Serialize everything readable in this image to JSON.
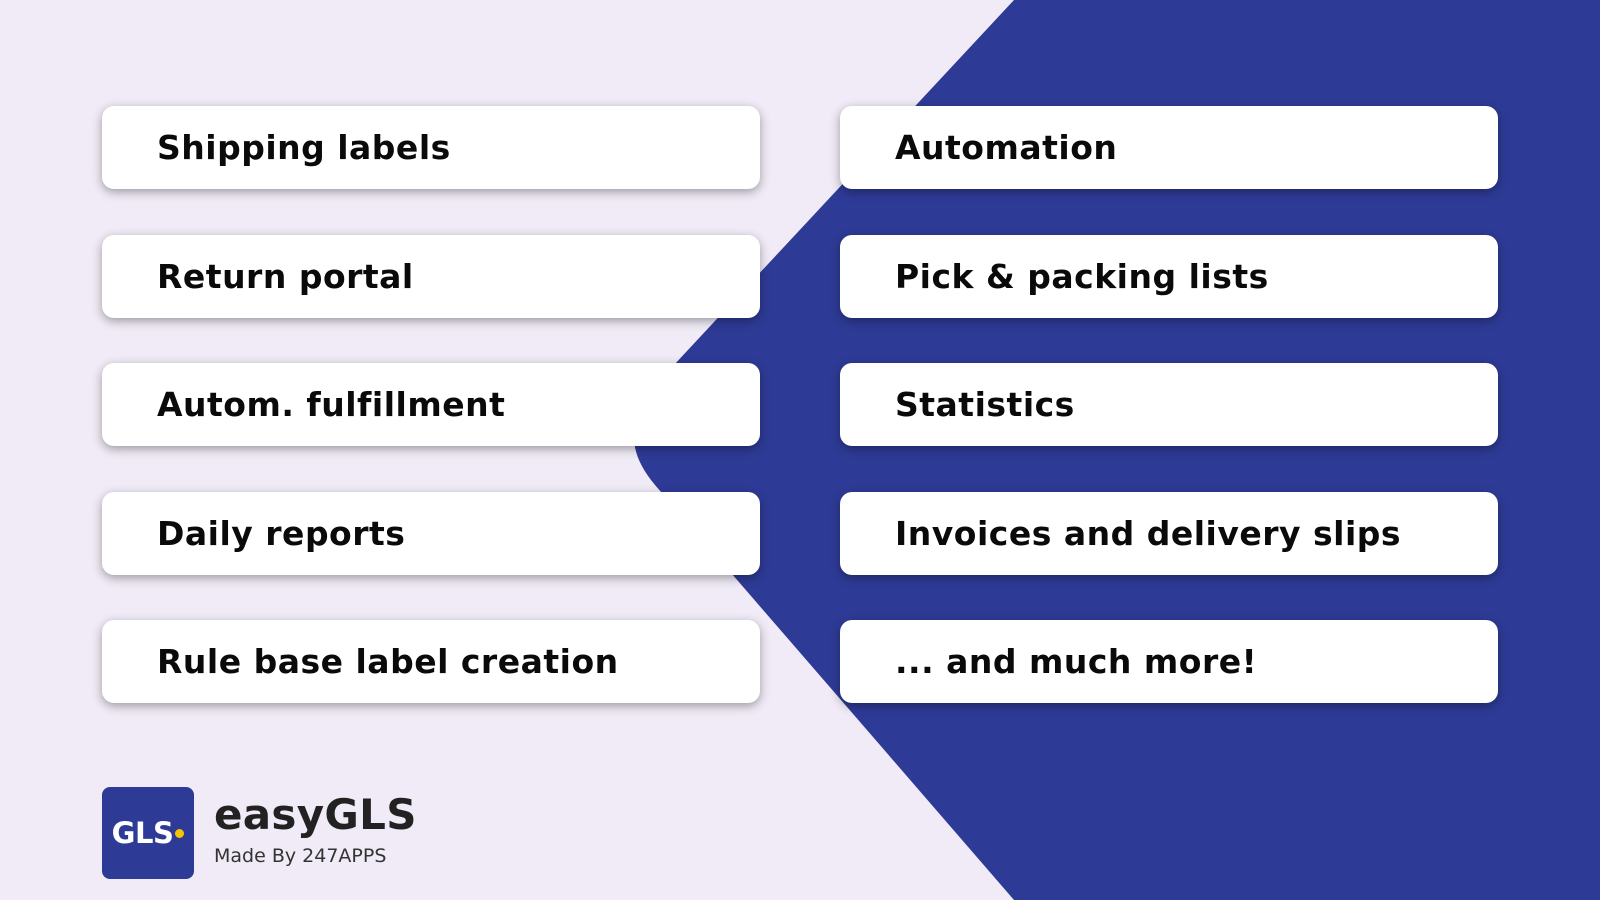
{
  "colors": {
    "background": "#f0ebf6",
    "accent_blue": "#2e3b96",
    "card": "#ffffff",
    "text": "#0a0a0a",
    "logo_dot": "#f5c400"
  },
  "features": {
    "left": [
      {
        "label": "Shipping labels"
      },
      {
        "label": "Return portal"
      },
      {
        "label": "Autom. fulfillment"
      },
      {
        "label": "Daily reports"
      },
      {
        "label": "Rule base label creation"
      }
    ],
    "right": [
      {
        "label": "Automation"
      },
      {
        "label": "Pick & packing lists"
      },
      {
        "label": "Statistics"
      },
      {
        "label": "Invoices and delivery slips"
      },
      {
        "label": "... and much more!"
      }
    ]
  },
  "brand": {
    "logo_text": "GLS",
    "name": "easyGLS",
    "tagline": "Made By 247APPS"
  }
}
